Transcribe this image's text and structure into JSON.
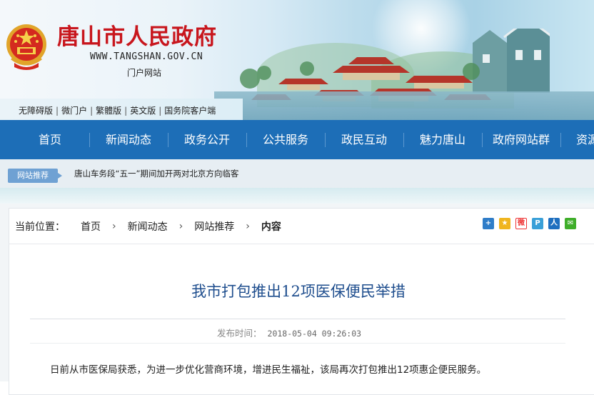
{
  "header": {
    "site_title": "唐山市人民政府",
    "site_url": "WWW.TANGSHAN.GOV.CN",
    "portal_label": "门户网站",
    "quick_links": [
      "无障碍版",
      "微门户",
      "繁體版",
      "英文版",
      "国务院客户端"
    ]
  },
  "nav": {
    "items": [
      "首页",
      "新闻动态",
      "政务公开",
      "公共服务",
      "政民互动",
      "魅力唐山",
      "政府网站群",
      "资源"
    ]
  },
  "notice": {
    "tag": "网站推荐",
    "text": "唐山车务段“五一”期间加开两对北京方向临客"
  },
  "breadcrumb": {
    "label": "当前位置：",
    "items": [
      "首页",
      "新闻动态",
      "网站推荐"
    ],
    "current": "内容"
  },
  "share_icons": [
    "plus-share-icon",
    "qzone-icon",
    "weibo-icon",
    "tencent-weibo-icon",
    "renren-icon",
    "wechat-icon"
  ],
  "article": {
    "title": "我市打包推出12项医保便民举措",
    "publish_label": "发布时间：",
    "publish_time": "2018-05-04 09:26:03",
    "first_paragraph": "日前从市医保局获悉，为进一步优化营商环境，增进民生福祉，该局再次打包推出12项惠企便民服务。"
  },
  "colors": {
    "nav_bg": "#1d6eb7",
    "title_red": "#c8161d",
    "article_title": "#1f4e8e",
    "notice_tag": "#6fa1d3"
  }
}
